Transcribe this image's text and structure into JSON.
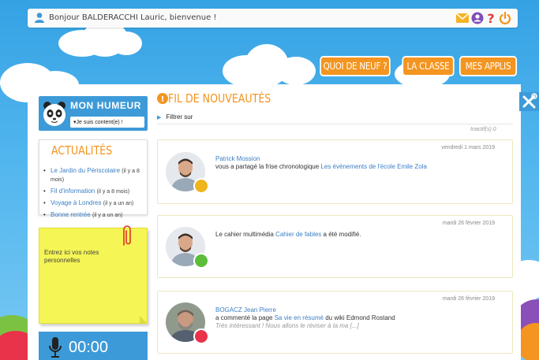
{
  "header": {
    "greeting": "Bonjour BALDERACCHI Lauric, bienvenue !",
    "user_icon": "user-icon",
    "icons": [
      "mail-icon",
      "account-icon",
      "help-icon",
      "power-icon"
    ],
    "icon_colors": {
      "mail": "#f5b324",
      "account": "#7f4fb8",
      "help": "#e03b3b",
      "power": "#f39520"
    }
  },
  "nav": {
    "items": [
      {
        "label": "QUOI DE NEUF ?"
      },
      {
        "label": "LA CLASSE"
      },
      {
        "label": "MES APPLIS"
      }
    ],
    "accent": "#f39520"
  },
  "humeur": {
    "title": "MON HUMEUR",
    "selected": "▾Je suis content(e) !"
  },
  "actualites": {
    "title": "ACTUALITÉS",
    "items": [
      {
        "label": "Le Jardin du Périscolaire",
        "ago": "(il y a 8 mois)"
      },
      {
        "label": "Fil d'information",
        "ago": "(il y a 8 mois)"
      },
      {
        "label": "Voyage à Londres",
        "ago": "(il y a un an)"
      },
      {
        "label": "Bonne rentrée",
        "ago": "(il y a un an)"
      }
    ]
  },
  "notes": {
    "placeholder": "Entrez ici vos notes personnelles"
  },
  "timer": {
    "value": "00:00"
  },
  "feed": {
    "title": "FIL DE NOUVEAUTÉS",
    "filter_label": "Filtrer sur",
    "inactive": "Inactif(s) 0",
    "cards": [
      {
        "date": "vendredi 1 mars 2019",
        "author": "Patrick Mossion",
        "text_before": "vous a partagé la frise chronologique ",
        "link": "Les évènements de l'école Emile Zola",
        "text_after": "",
        "quote": "",
        "badge_color": "#f0b41c"
      },
      {
        "date": "mardi 26 février 2019",
        "author": "",
        "text_before": "Le cahier multimédia ",
        "link": "Cahier de fables",
        "text_after": " a été modifié.",
        "quote": "",
        "badge_color": "#5bbd3a"
      },
      {
        "date": "mardi 26 février 2019",
        "author": "BOGACZ Jean Pierre",
        "text_before": "a commenté la page ",
        "link": "Sa vie en résumé",
        "text_after": " du wiki Edmond Rostand",
        "quote": "Très intéressant ! Nous allons le réviser à la ma [...]",
        "badge_color": "#e8334a"
      }
    ]
  }
}
